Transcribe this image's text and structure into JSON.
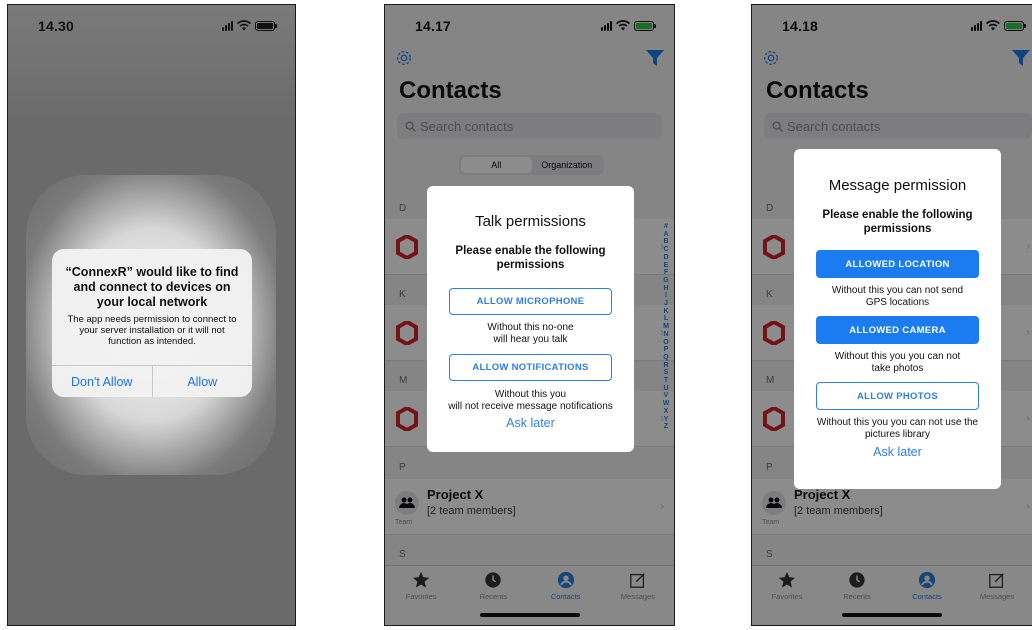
{
  "screen1": {
    "status_time": "14.30",
    "alert": {
      "title": "“ConnexR” would like to find and connect to devices on your local network",
      "message": "The app needs permission to connect to your server installation or it will not function as intended.",
      "deny_label": "Don't Allow",
      "allow_label": "Allow"
    }
  },
  "screen2": {
    "status_time": "14.17",
    "app_title": "Contacts",
    "search_placeholder": "Search contacts",
    "segments": [
      "All",
      "Organization"
    ],
    "sections": [
      "D",
      "K",
      "M",
      "P",
      "S"
    ],
    "team_row": {
      "name": "Project X",
      "subtitle": "[2 team members]",
      "badge": "Team"
    },
    "index_letters": [
      "#",
      "A",
      "B",
      "C",
      "D",
      "E",
      "F",
      "G",
      "H",
      "I",
      "J",
      "K",
      "L",
      "M",
      "N",
      "O",
      "P",
      "Q",
      "R",
      "S",
      "T",
      "U",
      "V",
      "W",
      "X",
      "Y",
      "Z"
    ],
    "tabs": [
      "Favorites",
      "Recents",
      "Contacts",
      "Messages"
    ],
    "dialog": {
      "title": "Talk permissions",
      "subtitle": "Please enable the following permissions",
      "btn_microphone": "ALLOW MICROPHONE",
      "note_microphone_l1": "Without this no-one",
      "note_microphone_l2": "will hear you talk",
      "btn_notifications": "ALLOW NOTIFICATIONS",
      "note_notifications_l1": "Without this you",
      "note_notifications_l2": "will not receive message notifications",
      "ask_later": "Ask later"
    }
  },
  "screen3": {
    "status_time": "14.18",
    "app_title": "Contacts",
    "search_placeholder": "Search contacts",
    "sections": [
      "D",
      "K",
      "M",
      "P",
      "S"
    ],
    "team_row": {
      "name": "Project X",
      "subtitle": "[2 team members]",
      "badge": "Team"
    },
    "tabs": [
      "Favorites",
      "Recents",
      "Contacts",
      "Messages"
    ],
    "dialog": {
      "title": "Message permission",
      "subtitle": "Please enable the following permissions",
      "btn_location": "ALLOWED LOCATION",
      "note_location": "Without this you can not send GPS locations",
      "btn_camera": "ALLOWED CAMERA",
      "note_camera": "Without this you you can not take photos",
      "btn_photos": "ALLOW PHOTOS",
      "note_photos": "Without this you you can not use the pictures library",
      "ask_later": "Ask later"
    }
  },
  "colors": {
    "accent": "#2f7fe0",
    "filled_button": "#1a7cf0",
    "logo_red": "#d1232a",
    "ios_link": "#1a73e8"
  }
}
